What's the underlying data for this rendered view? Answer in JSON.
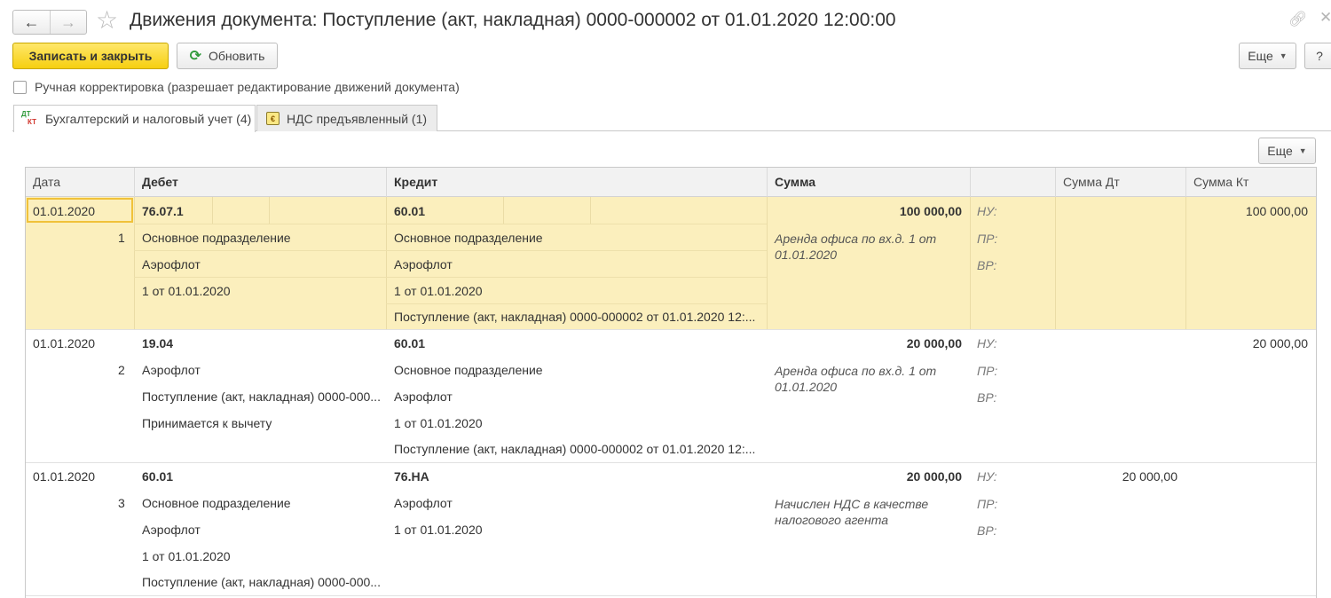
{
  "window": {
    "title": "Движения документа: Поступление (акт, накладная) 0000-000002 от 01.01.2020 12:00:00"
  },
  "toolbar": {
    "save_close": "Записать и закрыть",
    "refresh": "Обновить",
    "more": "Еще",
    "help": "?"
  },
  "manual_correction": {
    "label": "Ручная корректировка (разрешает редактирование движений документа)",
    "checked": false
  },
  "tabs": [
    {
      "label": "Бухгалтерский и налоговый учет (4)",
      "active": true,
      "icon": "dt-kt-icon"
    },
    {
      "label": "НДС предъявленный (1)",
      "active": false,
      "icon": "vat-register-icon"
    }
  ],
  "table_toolbar": {
    "more": "Еще"
  },
  "table": {
    "columns": [
      "Дата",
      "Дебет",
      "Кредит",
      "Сумма",
      "",
      "Сумма Дт",
      "Сумма Кт"
    ],
    "rows": [
      {
        "date": "01.01.2020",
        "num": "1",
        "debit": {
          "account": "76.07.1",
          "lines": [
            "Основное подразделение",
            "Аэрофлот",
            "1 от 01.01.2020"
          ]
        },
        "credit": {
          "account": "60.01",
          "lines": [
            "Основное подразделение",
            "Аэрофлот",
            "1 от 01.01.2020",
            "Поступление (акт, накладная) 0000-000002 от 01.01.2020 12:..."
          ]
        },
        "amount": "100 000,00",
        "content": "Аренда офиса по вх.д. 1 от 01.01.2020",
        "tax_labels": [
          "НУ:",
          "ПР:",
          "ВР:"
        ],
        "sum_dt": "",
        "sum_kt": "100 000,00",
        "selected": true
      },
      {
        "date": "01.01.2020",
        "num": "2",
        "debit": {
          "account": "19.04",
          "lines": [
            "Аэрофлот",
            "Поступление (акт, накладная) 0000-000...",
            "Принимается к вычету"
          ]
        },
        "credit": {
          "account": "60.01",
          "lines": [
            "Основное подразделение",
            "Аэрофлот",
            "1 от 01.01.2020",
            "Поступление (акт, накладная) 0000-000002 от 01.01.2020 12:..."
          ]
        },
        "amount": "20 000,00",
        "content": "Аренда офиса по вх.д. 1 от 01.01.2020",
        "tax_labels": [
          "НУ:",
          "ПР:",
          "ВР:"
        ],
        "sum_dt": "",
        "sum_kt": "20 000,00",
        "selected": false
      },
      {
        "date": "01.01.2020",
        "num": "3",
        "debit": {
          "account": "60.01",
          "lines": [
            "Основное подразделение",
            "Аэрофлот",
            "1 от 01.01.2020",
            "Поступление (акт, накладная) 0000-000..."
          ]
        },
        "credit": {
          "account": "76.НА",
          "lines": [
            "Аэрофлот",
            "1 от 01.01.2020"
          ]
        },
        "amount": "20 000,00",
        "content": "Начислен НДС в качестве налогового агента",
        "tax_labels": [
          "НУ:",
          "ПР:",
          "ВР:"
        ],
        "sum_dt": "20 000,00",
        "sum_kt": "",
        "selected": false
      }
    ]
  },
  "colors": {
    "accent_yellow": "#f6cf10",
    "selected_row": "#fbefbd",
    "selected_border": "#f0c23a",
    "refresh_green": "#2f9a3a"
  }
}
